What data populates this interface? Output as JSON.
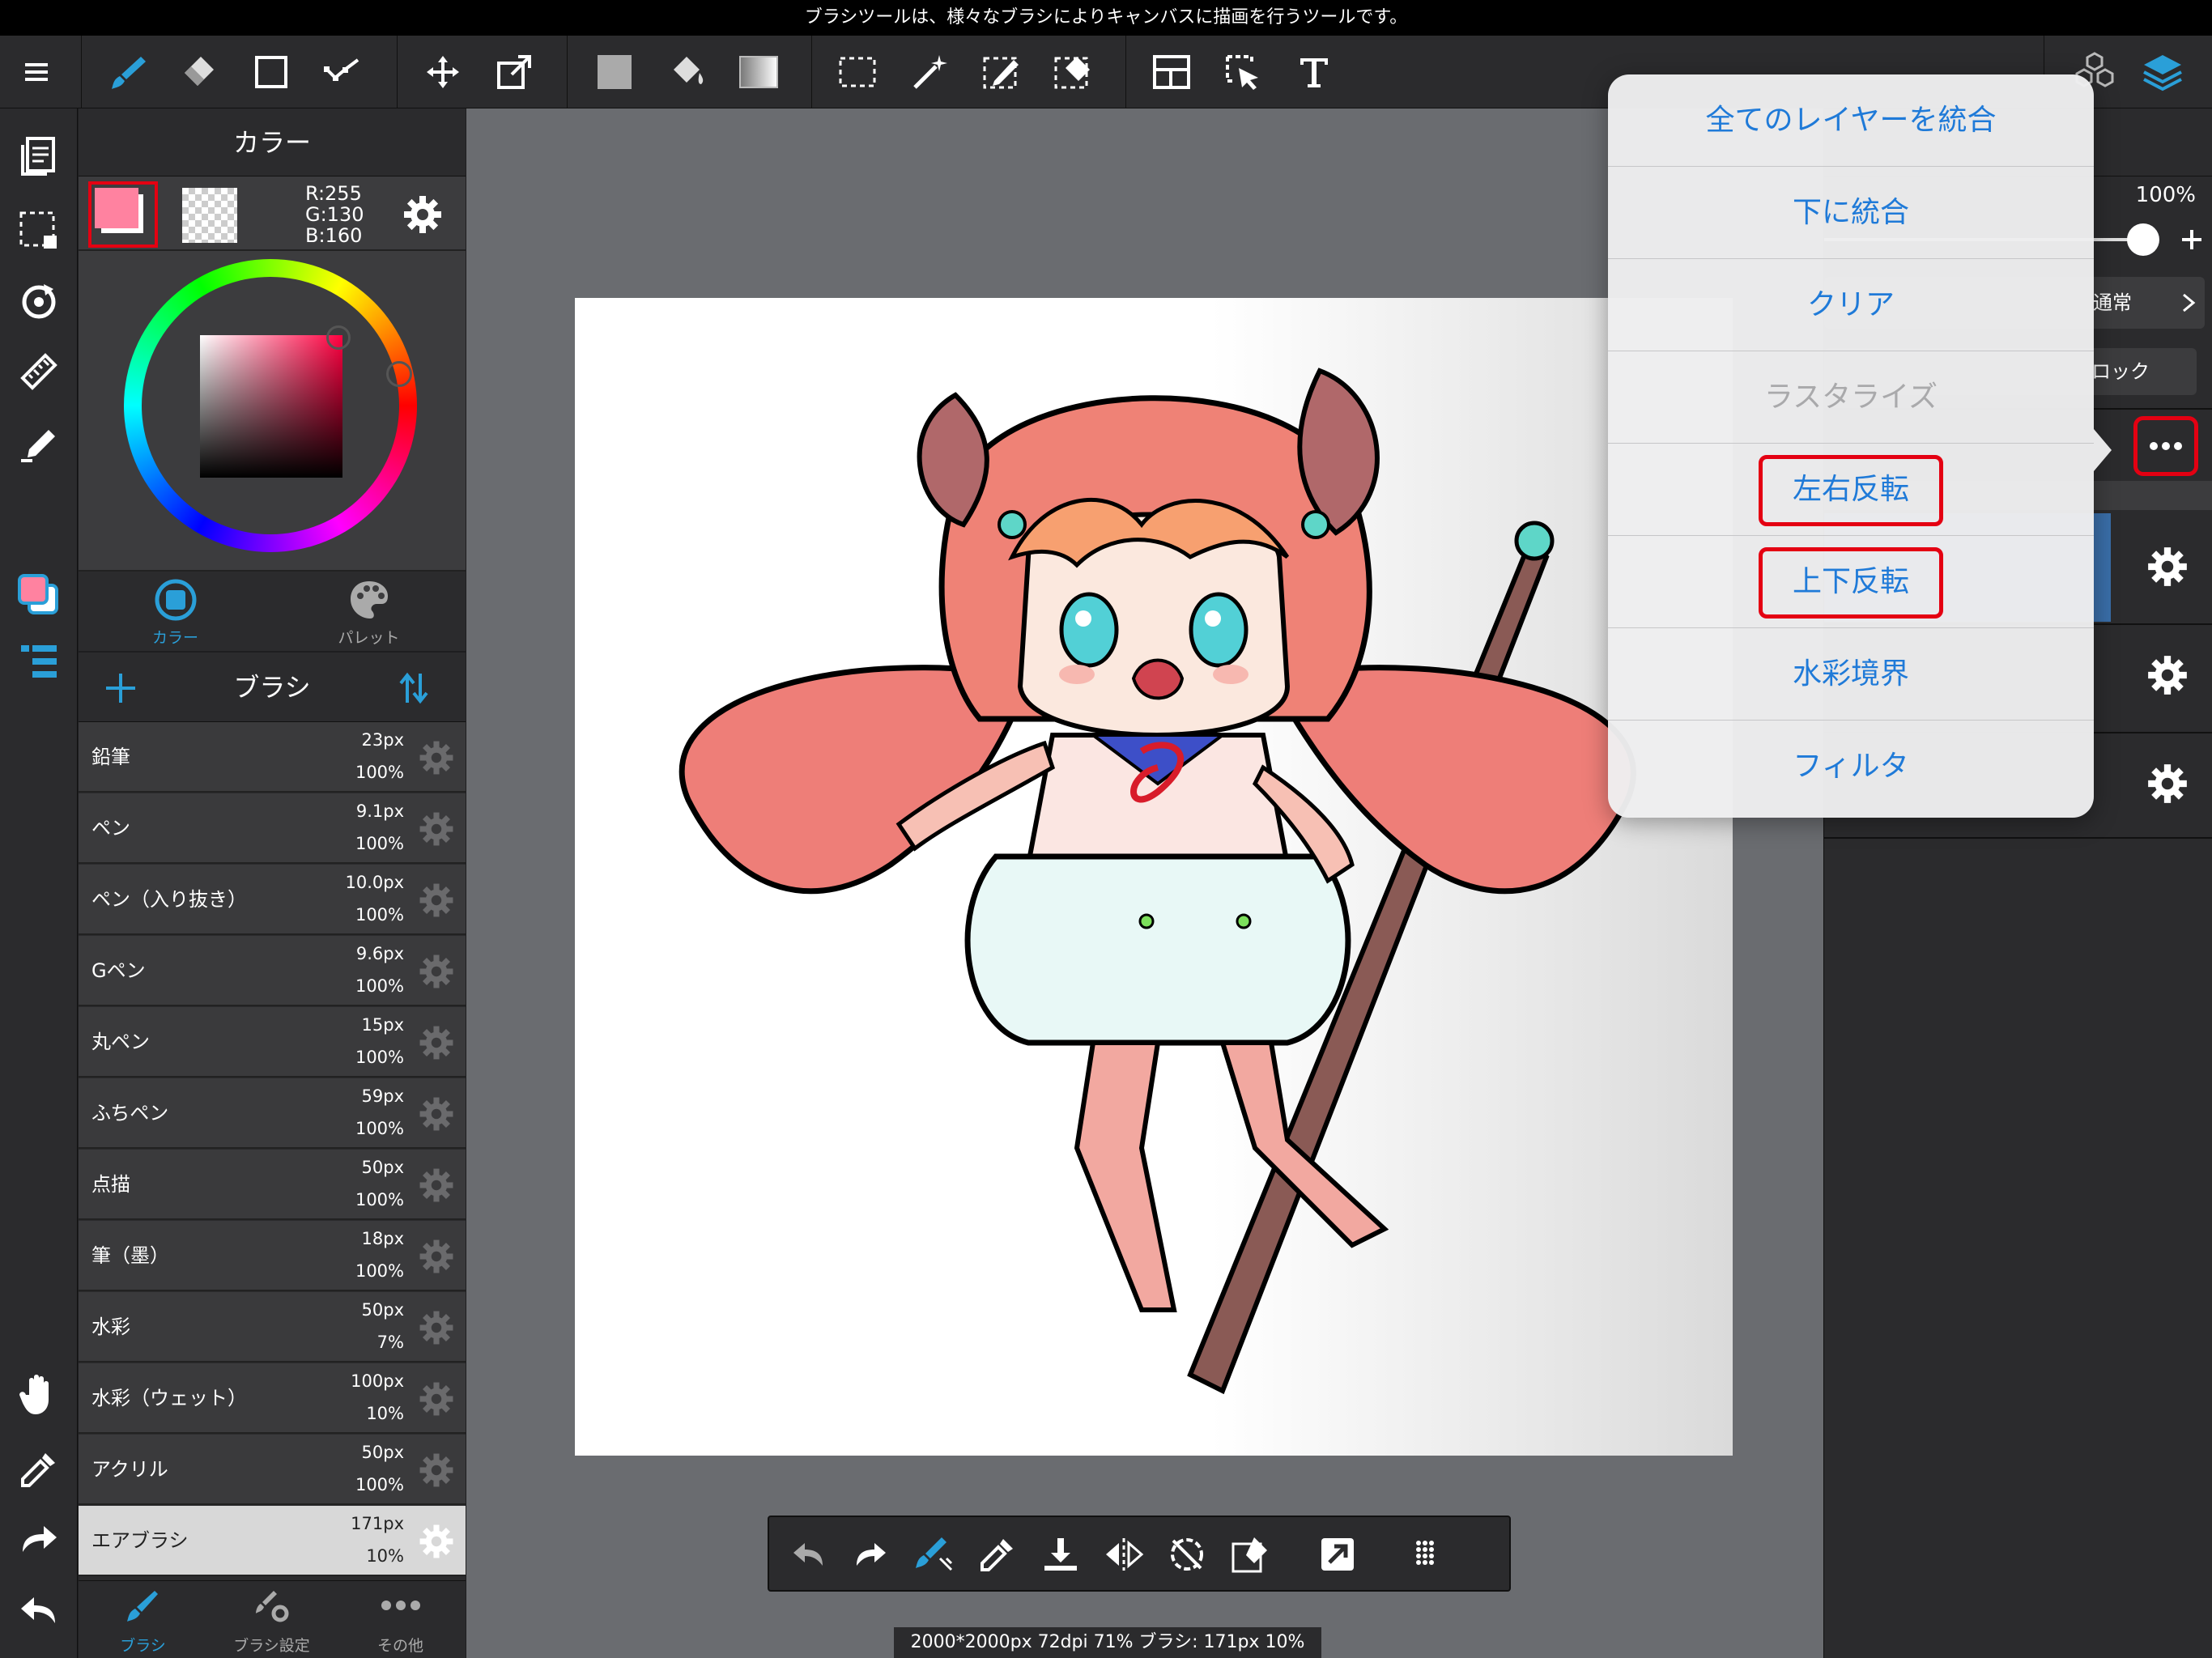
{
  "hint_bar": {
    "text": "ブラシツールは、様々なブラシによりキャンバスに描画を行うツールです。"
  },
  "color_panel": {
    "title": "カラー",
    "primary_color": "#ff82a0",
    "r": "R:255",
    "g": "G:130",
    "b": "B:160",
    "tabs": [
      {
        "label": "カラー"
      },
      {
        "label": "パレット"
      }
    ]
  },
  "brush_panel": {
    "title": "ブラシ",
    "brushes": [
      {
        "name": "鉛筆",
        "size": "23px",
        "opacity": "100%"
      },
      {
        "name": "ペン",
        "size": "9.1px",
        "opacity": "100%"
      },
      {
        "name": "ペン（入り抜き）",
        "size": "10.0px",
        "opacity": "100%"
      },
      {
        "name": "Gペン",
        "size": "9.6px",
        "opacity": "100%"
      },
      {
        "name": "丸ペン",
        "size": "15px",
        "opacity": "100%"
      },
      {
        "name": "ふちペン",
        "size": "59px",
        "opacity": "100%"
      },
      {
        "name": "点描",
        "size": "50px",
        "opacity": "100%"
      },
      {
        "name": "筆（墨）",
        "size": "18px",
        "opacity": "100%"
      },
      {
        "name": "水彩",
        "size": "50px",
        "opacity": "7%"
      },
      {
        "name": "水彩（ウェット）",
        "size": "100px",
        "opacity": "10%"
      },
      {
        "name": "アクリル",
        "size": "50px",
        "opacity": "100%"
      },
      {
        "name": "エアブラシ",
        "size": "171px",
        "opacity": "10%"
      }
    ],
    "bottom_tabs": [
      {
        "label": "ブラシ"
      },
      {
        "label": "ブラシ設定"
      },
      {
        "label": "その他"
      }
    ]
  },
  "info_bar": {
    "text": "2000*2000px 72dpi 71% ブラシ: 171px 10%"
  },
  "layer_panel": {
    "opacity": "100%",
    "blend_mode": "通常",
    "lock_label": "ロック"
  },
  "popup_menu": {
    "items": [
      {
        "label": "全てのレイヤーを統合",
        "enabled": true
      },
      {
        "label": "下に統合",
        "enabled": true
      },
      {
        "label": "クリア",
        "enabled": true
      },
      {
        "label": "ラスタライズ",
        "enabled": false
      },
      {
        "label": "左右反転",
        "enabled": true
      },
      {
        "label": "上下反転",
        "enabled": true
      },
      {
        "label": "水彩境界",
        "enabled": true
      },
      {
        "label": "フィルタ",
        "enabled": true
      }
    ]
  },
  "colors": {
    "accent": "#1f7ad8",
    "highlight": "#e40012",
    "selected_tool": "#2a9fd8"
  },
  "icons": [
    "menu-icon",
    "brush-icon",
    "eraser-icon",
    "rectangle-icon",
    "select-path-icon",
    "move-icon",
    "transform-icon",
    "fill-color-icon",
    "bucket-icon",
    "gradient-icon",
    "marquee-icon",
    "magic-wand-icon",
    "select-pen-icon",
    "select-eraser-icon",
    "frame-icon",
    "operation-icon",
    "text-icon",
    "3d-icon",
    "layers-icon"
  ]
}
